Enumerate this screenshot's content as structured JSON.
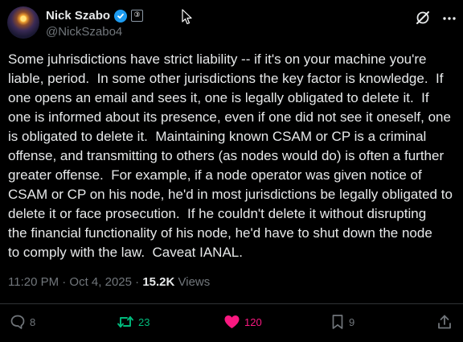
{
  "tweet": {
    "author_name": "Nick Szabo",
    "handle": "@NickSzabo4",
    "affiliate_badge": "③",
    "body_lines": [
      "Some juhrisdictions have strict liability -- if it's on your machine you're",
      "liable, period.  In some other jurisdictions the key factor is knowledge.  If",
      "one opens an email and sees it, one is legally obligated to delete it.  If",
      "one is informed about its presence, even if one did not see it oneself, one",
      "is obligated to delete it.  Maintaining known CSAM or CP is a criminal",
      "offense, and transmitting to others (as nodes would do) is often a further",
      "greater offense.  For example, if a node operator was given notice of",
      "CSAM or CP on his node, he'd in most jurisdictions be legally obligated to",
      "delete it or face prosecution.  If he couldn't delete it without disrupting",
      "the financial functionality of his node, he'd have to shut down the node",
      "to comply with the law.  Caveat IANAL."
    ],
    "timestamp": "11:20 PM · Oct 4, 2025 · ",
    "views_count": "15.2K",
    "views_label": " Views"
  },
  "actions": {
    "replies": "8",
    "reposts": "23",
    "likes": "120",
    "bookmarks": "9"
  },
  "colors": {
    "background": "#000000",
    "text": "#e7e9ea",
    "muted": "#71767b",
    "verified": "#1d9bf0",
    "repost": "#00ba7c",
    "like": "#f91880"
  },
  "icons": [
    "verified-check-icon",
    "cursor-icon",
    "grok-icon",
    "more-icon",
    "reply-icon",
    "repost-icon",
    "like-icon",
    "bookmark-icon",
    "share-icon"
  ]
}
